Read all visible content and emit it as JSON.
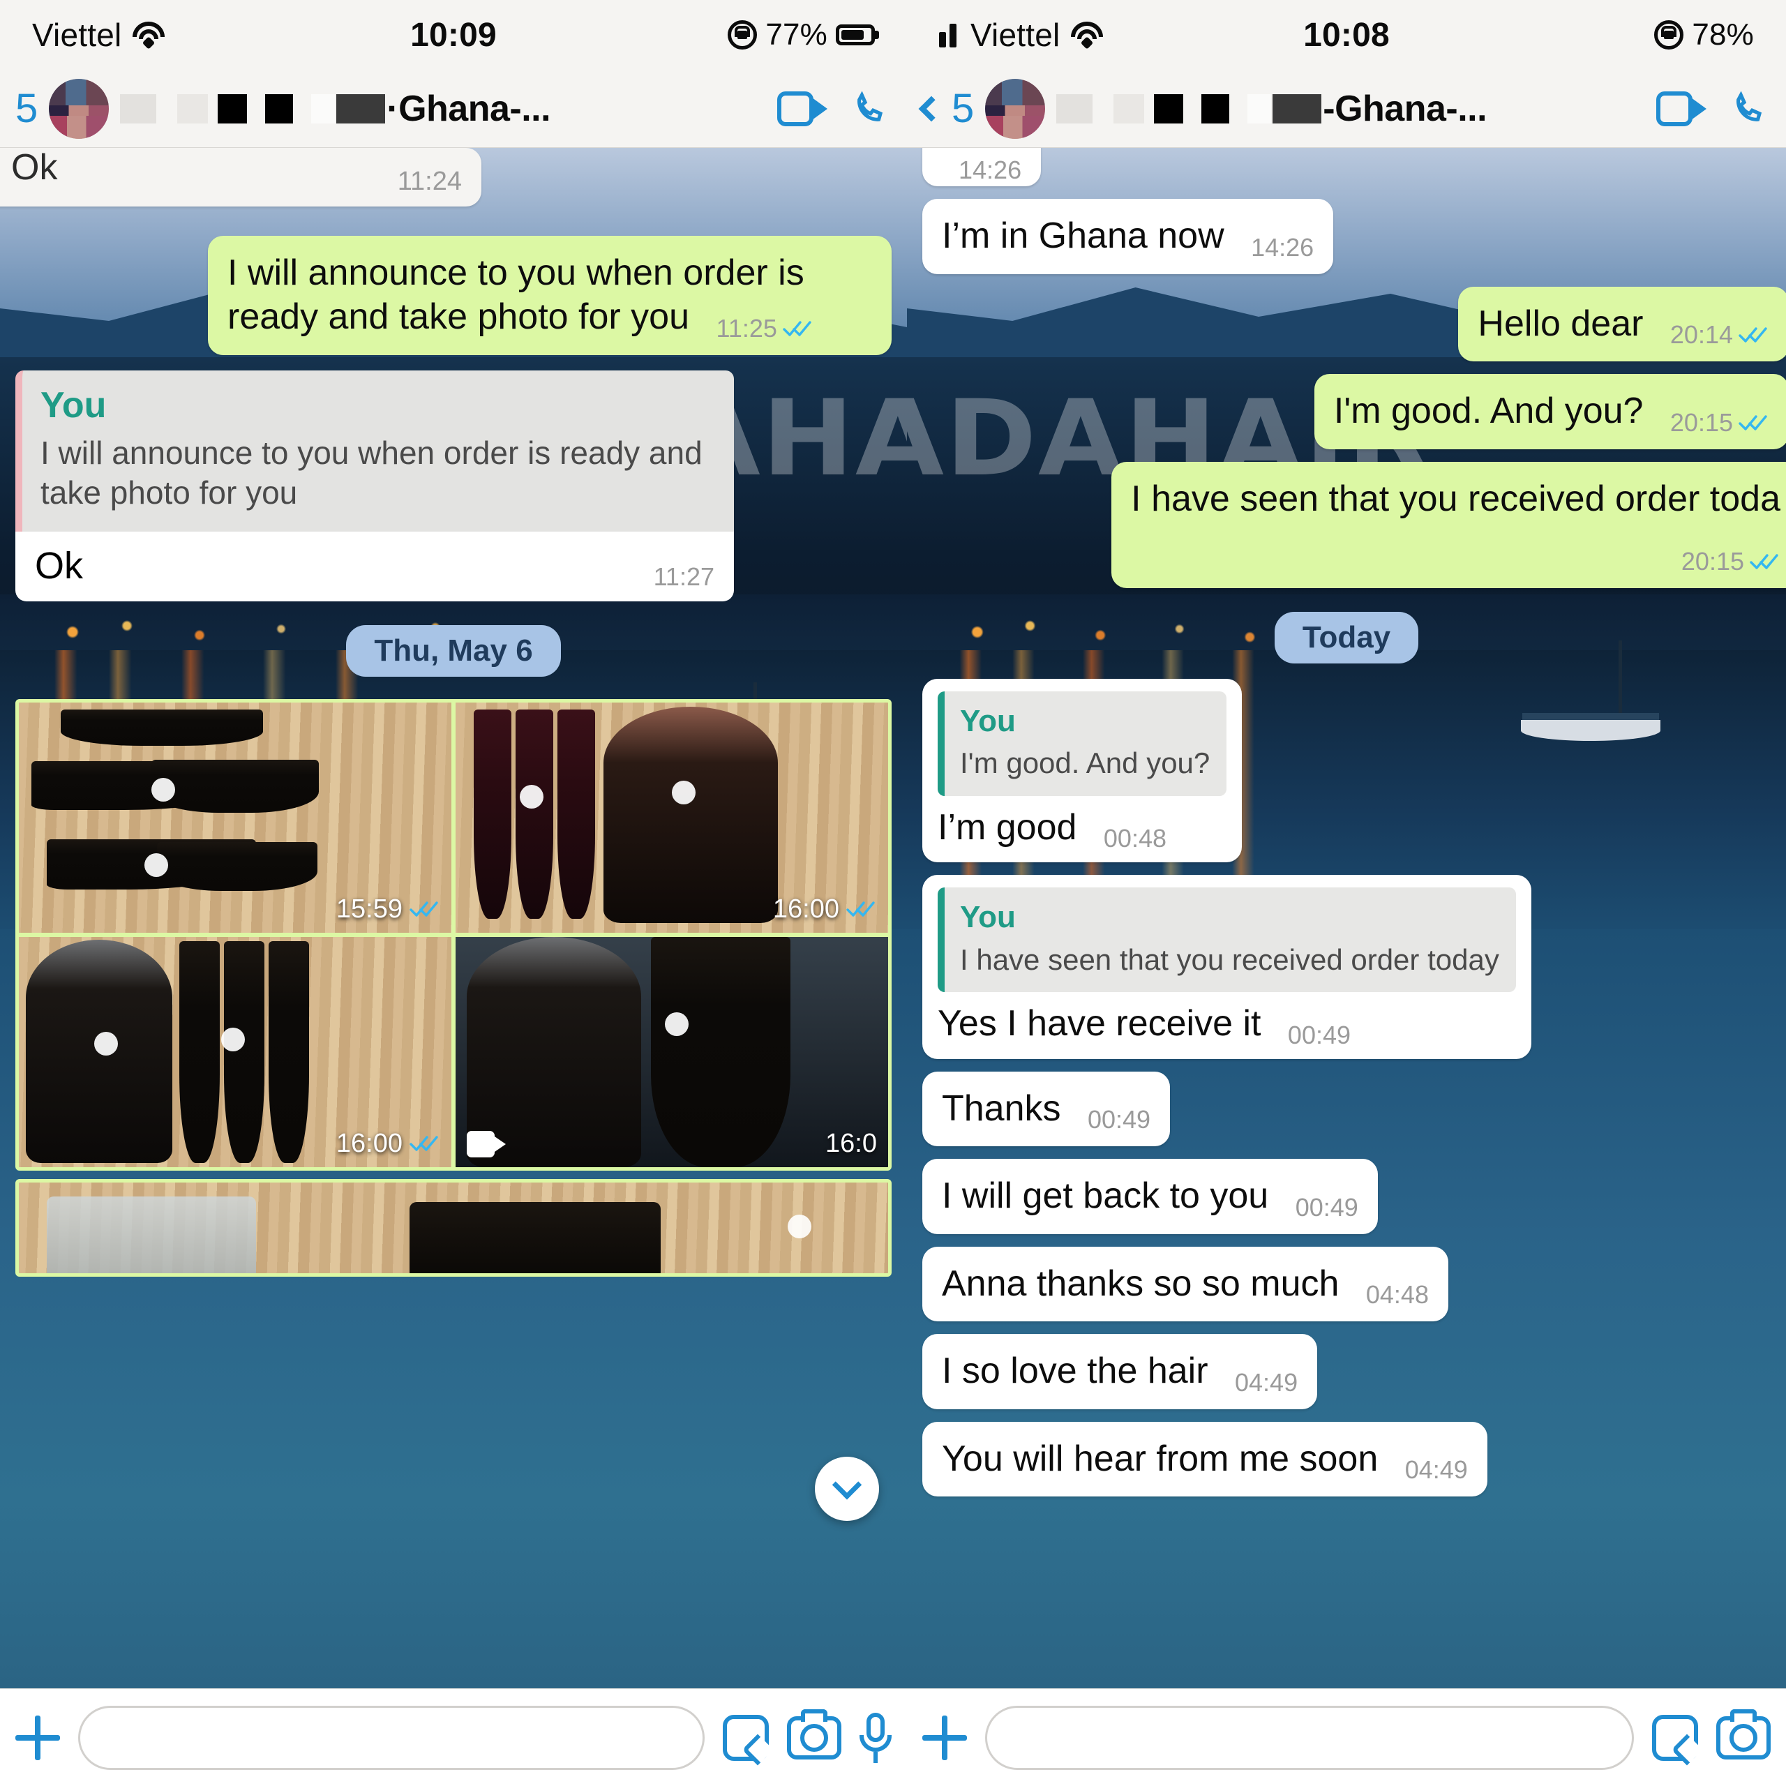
{
  "left_phone": {
    "status_bar": {
      "carrier": "Viettel",
      "wifi_icon": "wifi-icon",
      "time": "10:09",
      "rotation_lock_icon": "rotation-lock-icon",
      "battery_percent": "77%",
      "battery_icon": "battery-icon"
    },
    "chat_header": {
      "back_icon": "back-chevron-icon",
      "unread_count": "5",
      "avatar": "contact-avatar",
      "contact_name": "·Ghana-...",
      "video_call_icon": "video-call-icon",
      "voice_call_icon": "phone-call-icon"
    },
    "messages": [
      {
        "id": "m0",
        "dir": "in",
        "text": "Ok",
        "time": "11:24",
        "clipped_top": true
      },
      {
        "id": "m1",
        "dir": "out",
        "text": "I will announce to you when order is ready and take photo for you",
        "time": "11:25",
        "ticks": "double-check-blue"
      },
      {
        "id": "m2",
        "dir": "in",
        "quote_name": "You",
        "quote_text": "I will announce to you when order is ready and take photo for you",
        "text": "Ok",
        "time": "11:27"
      }
    ],
    "date_pill": "Thu, May 6",
    "photo_grid": [
      {
        "id": "p1",
        "time": "15:59",
        "ticks": "double-check-blue",
        "kind": "photo"
      },
      {
        "id": "p2",
        "time": "16:00",
        "ticks": "double-check-blue",
        "kind": "photo"
      },
      {
        "id": "p3",
        "time": "16:00",
        "ticks": "double-check-blue",
        "kind": "photo"
      },
      {
        "id": "p4",
        "time": "16:0",
        "ticks": "",
        "kind": "video"
      }
    ],
    "scroll_down_icon": "scroll-to-bottom-icon",
    "composer": {
      "attach_icon": "plus-attach-icon",
      "input_placeholder": "",
      "input_value": "",
      "sticker_icon": "sticker-icon",
      "camera_icon": "camera-icon",
      "mic_icon": "microphone-icon"
    }
  },
  "right_phone": {
    "status_bar": {
      "signal_icon": "cellular-signal-icon",
      "carrier": "Viettel",
      "wifi_icon": "wifi-icon",
      "time": "10:08",
      "rotation_lock_icon": "rotation-lock-icon",
      "battery_percent": "78%",
      "battery_icon": "battery-icon"
    },
    "chat_header": {
      "back_icon": "back-chevron-icon",
      "unread_count": "5",
      "avatar": "contact-avatar",
      "contact_name": "-Ghana-...",
      "video_call_icon": "video-call-icon",
      "voice_call_icon": "phone-call-icon"
    },
    "messages": [
      {
        "id": "r0",
        "dir": "in",
        "text": "",
        "time": "14:26",
        "clipped_top": true
      },
      {
        "id": "r1",
        "dir": "in",
        "text": "I’m in Ghana now",
        "time": "14:26"
      },
      {
        "id": "r2",
        "dir": "out",
        "text": "Hello dear",
        "time": "20:14",
        "ticks": "double-check-blue"
      },
      {
        "id": "r3",
        "dir": "out",
        "text": "I'm good. And you?",
        "time": "20:15",
        "ticks": "double-check-blue"
      },
      {
        "id": "r4",
        "dir": "out",
        "text": "I have seen that you received order toda",
        "time": "20:15",
        "ticks": "double-check-blue"
      },
      {
        "id": "r5",
        "dir": "in",
        "quote_name": "You",
        "quote_text": "I'm good. And you?",
        "text": "I’m good",
        "time": "00:48"
      },
      {
        "id": "r6",
        "dir": "in",
        "quote_name": "You",
        "quote_text": "I have seen that you received order today",
        "text": "Yes I have receive it",
        "time": "00:49"
      },
      {
        "id": "r7",
        "dir": "in",
        "text": "Thanks",
        "time": "00:49"
      },
      {
        "id": "r8",
        "dir": "in",
        "text": "I will get back to you",
        "time": "00:49"
      },
      {
        "id": "r9",
        "dir": "in",
        "text": "Anna thanks so so much",
        "time": "04:48"
      },
      {
        "id": "r10",
        "dir": "in",
        "text": "I so love the hair",
        "time": "04:49"
      },
      {
        "id": "r11",
        "dir": "in",
        "text": "You will hear from me soon",
        "time": "04:49"
      }
    ],
    "date_pill": "Today",
    "composer": {
      "attach_icon": "plus-attach-icon",
      "input_placeholder": "",
      "input_value": "",
      "sticker_icon": "sticker-icon",
      "camera_icon": "camera-icon"
    }
  },
  "watermark": {
    "text": "HADAHAIR"
  },
  "colors": {
    "outgoing_bubble": "#dcf8a4",
    "incoming_bubble": "#ffffff",
    "accent_blue": "#1f8cd1",
    "quote_accent": "#1f9b86",
    "date_pill": "#a8c4e6",
    "tick_blue": "#34b7f1"
  }
}
